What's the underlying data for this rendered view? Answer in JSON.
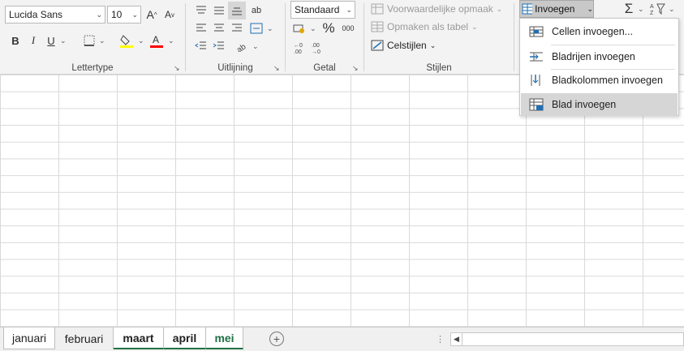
{
  "font_group": {
    "font_name": "Lucida Sans",
    "font_size": "10",
    "label": "Lettertype",
    "buttons": {
      "bold": "B",
      "italic": "I",
      "underline": "U"
    }
  },
  "alignment_group": {
    "label": "Uitlijning",
    "wrap_glyph": "ab"
  },
  "number_group": {
    "label": "Getal",
    "format": "Standaard",
    "percent": "%",
    "thousands": "000"
  },
  "styles_group": {
    "label": "Stijlen",
    "conditional": "Voorwaardelijke opmaak",
    "as_table": "Opmaken als tabel",
    "cell_styles": "Celstijlen"
  },
  "cells_group": {
    "insert_button": "Invoegen"
  },
  "insert_menu": {
    "items": [
      {
        "label": "Cellen invoegen..."
      },
      {
        "label": "Bladrijen invoegen"
      },
      {
        "label": "Bladkolommen invoegen"
      },
      {
        "label": "Blad invoegen"
      }
    ]
  },
  "sheet_tabs": [
    {
      "label": "januari"
    },
    {
      "label": "februari"
    },
    {
      "label": "maart"
    },
    {
      "label": "april"
    },
    {
      "label": "mei"
    }
  ],
  "colors": {
    "accent_green": "#1e7145",
    "highlight_yellow": "#ffff00",
    "font_red": "#ff0000"
  }
}
